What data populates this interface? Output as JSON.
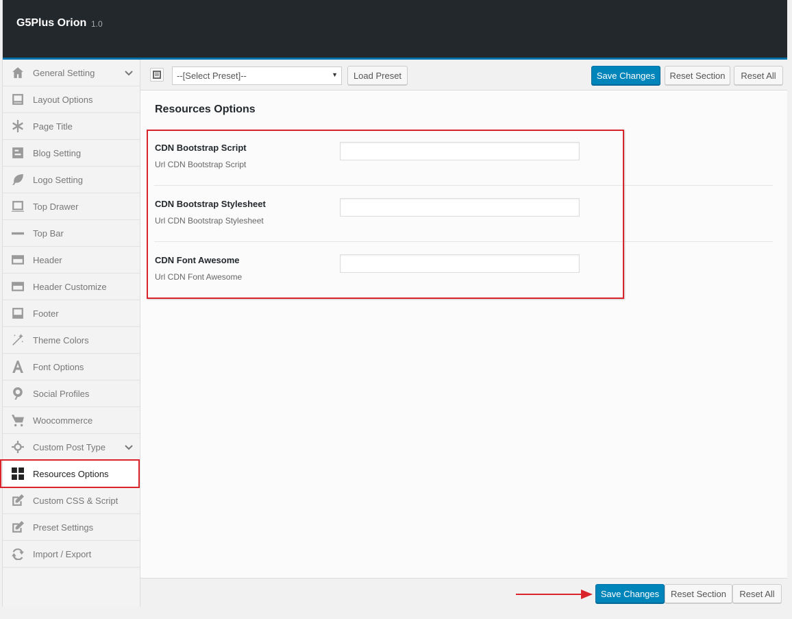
{
  "header": {
    "app_name": "G5Plus Orion",
    "version": "1.0"
  },
  "sidebar": {
    "items": [
      {
        "label": "General Setting",
        "icon": "home-icon"
      },
      {
        "label": "Layout Options",
        "icon": "layout-icon"
      },
      {
        "label": "Page Title",
        "icon": "asterisk-icon"
      },
      {
        "label": "Blog Setting",
        "icon": "blogger-icon"
      },
      {
        "label": "Logo Setting",
        "icon": "leaf-icon"
      },
      {
        "label": "Top Drawer",
        "icon": "laptop-icon"
      },
      {
        "label": "Top Bar",
        "icon": "minus-icon"
      },
      {
        "label": "Header",
        "icon": "header-icon"
      },
      {
        "label": "Header Customize",
        "icon": "header-customize-icon"
      },
      {
        "label": "Footer",
        "icon": "footer-icon"
      },
      {
        "label": "Theme Colors",
        "icon": "magic-wand-icon"
      },
      {
        "label": "Font Options",
        "icon": "font-icon"
      },
      {
        "label": "Social Profiles",
        "icon": "pinterest-icon"
      },
      {
        "label": "Woocommerce",
        "icon": "cart-icon"
      },
      {
        "label": "Custom Post Type",
        "icon": "crosshairs-icon"
      },
      {
        "label": "Resources Options",
        "icon": "grid-icon"
      },
      {
        "label": "Custom CSS & Script",
        "icon": "edit-icon"
      },
      {
        "label": "Preset Settings",
        "icon": "edit-icon"
      },
      {
        "label": "Import / Export",
        "icon": "refresh-icon"
      }
    ]
  },
  "toolbar": {
    "preset_placeholder": "--[Select Preset]--",
    "load_preset": "Load Preset",
    "save_changes": "Save Changes",
    "reset_section": "Reset Section",
    "reset_all": "Reset All"
  },
  "main": {
    "section_title": "Resources Options",
    "fields": [
      {
        "label": "CDN Bootstrap Script",
        "description": "Url CDN Bootstrap Script",
        "value": ""
      },
      {
        "label": "CDN Bootstrap Stylesheet",
        "description": "Url CDN Bootstrap Stylesheet",
        "value": ""
      },
      {
        "label": "CDN Font Awesome",
        "description": "Url CDN Font Awesome",
        "value": ""
      }
    ]
  },
  "footer": {
    "save_changes": "Save Changes",
    "reset_section": "Reset Section",
    "reset_all": "Reset All"
  },
  "colors": {
    "accent": "#0085ba",
    "highlight": "#d9242b",
    "topbar": "#23282d"
  }
}
